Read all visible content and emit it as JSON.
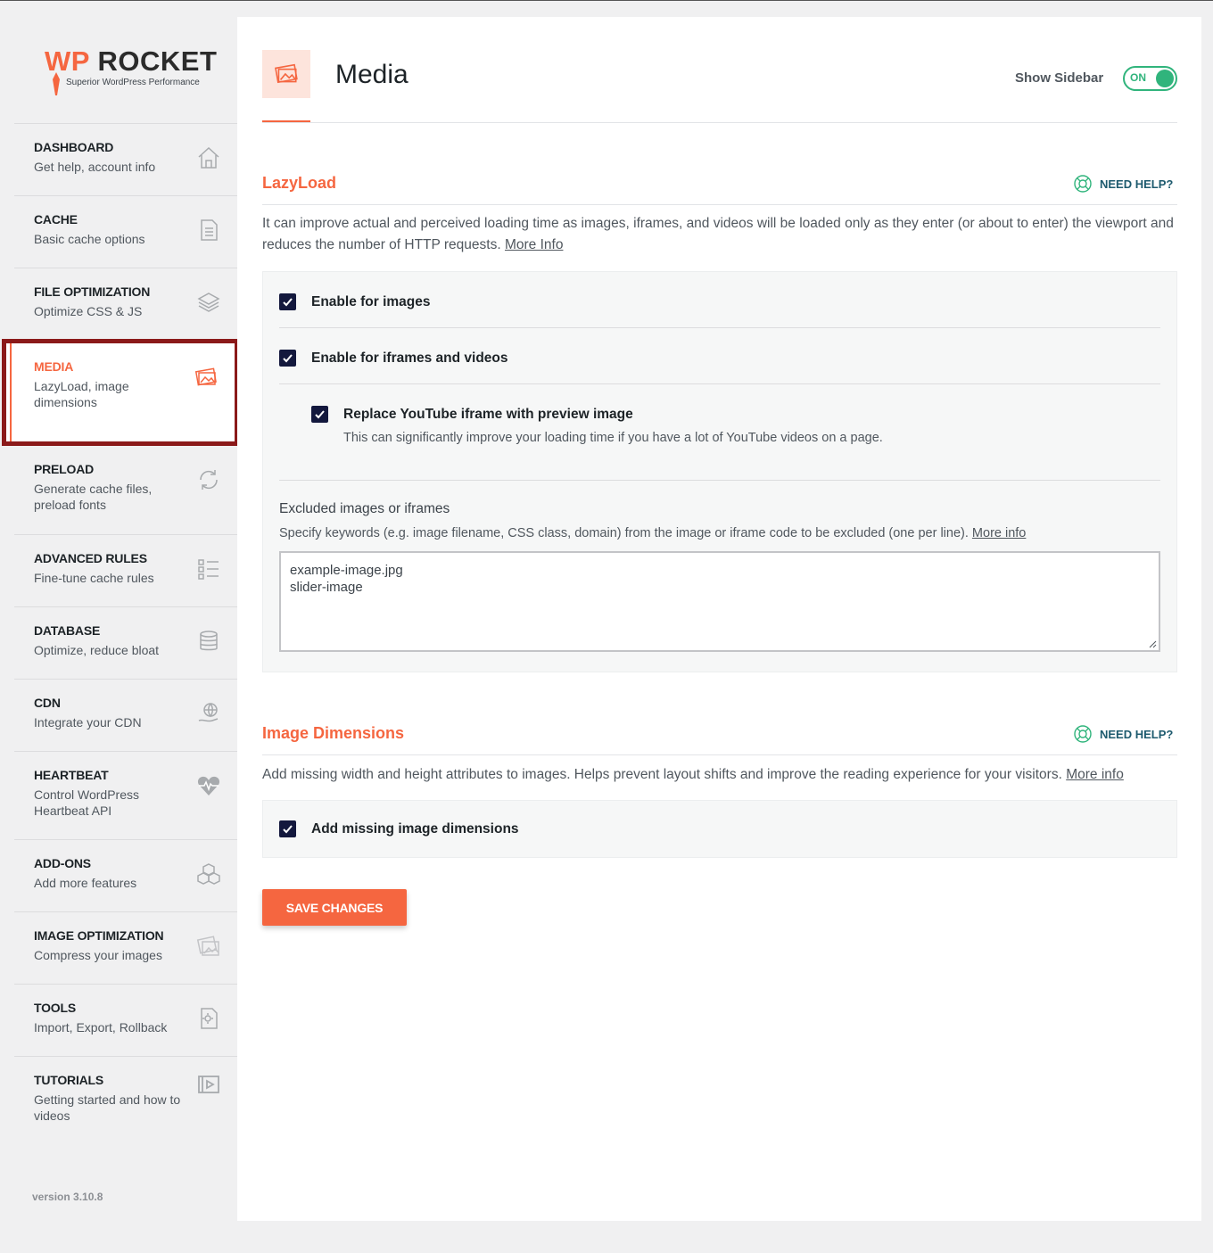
{
  "brand": {
    "logo_title_wp": "WP",
    "logo_title_rocket": " ROCKET",
    "logo_subtitle": "Superior WordPress Performance",
    "accent_color": "#f56640"
  },
  "sidebar": {
    "items": [
      {
        "title": "DASHBOARD",
        "desc": "Get help, account info",
        "icon": "home-icon"
      },
      {
        "title": "CACHE",
        "desc": "Basic cache options",
        "icon": "file-icon"
      },
      {
        "title": "FILE OPTIMIZATION",
        "desc": "Optimize CSS & JS",
        "icon": "layers-icon"
      },
      {
        "title": "MEDIA",
        "desc": "LazyLoad, image dimensions",
        "icon": "images-icon",
        "active": true
      },
      {
        "title": "PRELOAD",
        "desc": "Generate cache files, preload fonts",
        "icon": "refresh-icon"
      },
      {
        "title": "ADVANCED RULES",
        "desc": "Fine-tune cache rules",
        "icon": "list-icon"
      },
      {
        "title": "DATABASE",
        "desc": "Optimize, reduce bloat",
        "icon": "database-icon"
      },
      {
        "title": "CDN",
        "desc": "Integrate your CDN",
        "icon": "globe-hand-icon"
      },
      {
        "title": "HEARTBEAT",
        "desc": "Control WordPress Heartbeat API",
        "icon": "heartbeat-icon"
      },
      {
        "title": "ADD-ONS",
        "desc": "Add more features",
        "icon": "cubes-icon"
      },
      {
        "title": "IMAGE OPTIMIZATION",
        "desc": "Compress your images",
        "icon": "image-optimize-icon"
      },
      {
        "title": "TOOLS",
        "desc": "Import, Export, Rollback",
        "icon": "gear-file-icon"
      },
      {
        "title": "TUTORIALS",
        "desc": "Getting started and how to videos",
        "icon": "video-icon"
      }
    ],
    "version": "version 3.10.8"
  },
  "header": {
    "title": "Media",
    "show_sidebar_label": "Show Sidebar",
    "toggle_state": "ON"
  },
  "lazyload": {
    "title": "LazyLoad",
    "need_help": "NEED HELP?",
    "description": "It can improve actual and perceived loading time as images, iframes, and videos will be loaded only as they enter (or about to enter) the viewport and reduces the number of HTTP requests.",
    "more_info": "More Info",
    "options": {
      "images": {
        "label": "Enable for images",
        "checked": true
      },
      "iframes": {
        "label": "Enable for iframes and videos",
        "checked": true
      },
      "youtube": {
        "label": "Replace YouTube iframe with preview image",
        "checked": true,
        "desc": "This can significantly improve your loading time if you have a lot of YouTube videos on a page."
      }
    },
    "excluded": {
      "label": "Excluded images or iframes",
      "desc": "Specify keywords (e.g. image filename, CSS class, domain) from the image or iframe code to be excluded (one per line).",
      "more_info": "More info",
      "value": "example-image.jpg\nslider-image"
    }
  },
  "dimensions": {
    "title": "Image Dimensions",
    "need_help": "NEED HELP?",
    "description": "Add missing width and height attributes to images. Helps prevent layout shifts and improve the reading experience for your visitors.",
    "more_info": "More info",
    "option": {
      "label": "Add missing image dimensions",
      "checked": true
    }
  },
  "actions": {
    "save_label": "SAVE CHANGES"
  }
}
